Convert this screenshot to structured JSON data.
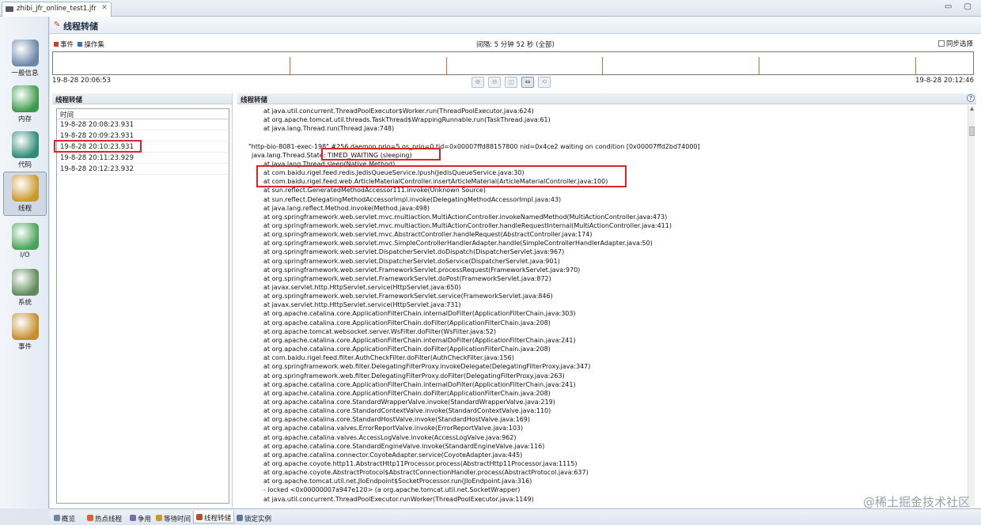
{
  "window": {
    "file_tab": "zhibi_jfr_online_test1.jfr",
    "close_glyph": "✕",
    "window_buttons": "▭ ▢"
  },
  "sidebar": {
    "items": [
      {
        "label": "一般信息",
        "icon": "chart-monitor-icon",
        "color": "#6b86a6"
      },
      {
        "label": "内存",
        "icon": "memory-chip-icon",
        "color": "#3c9a4c"
      },
      {
        "label": "代码",
        "icon": "code-java-icon",
        "color": "#2f8a76"
      },
      {
        "label": "线程",
        "icon": "thread-gears-icon",
        "color": "#c99a2e"
      },
      {
        "label": "I/O",
        "icon": "io-disk-icon",
        "color": "#4aa357"
      },
      {
        "label": "系统",
        "icon": "system-monitor-icon",
        "color": "#5f8a5a"
      },
      {
        "label": "事件",
        "icon": "event-folder-icon",
        "color": "#c68d2a"
      }
    ],
    "active_index": 3
  },
  "header": {
    "title": "线程转储",
    "icon": "thread-dump-icon"
  },
  "toolbar": {
    "legend_events": "事件",
    "legend_ops": "操作集",
    "event_color": "#d23a2a",
    "ops_color": "#3a6fb0",
    "range_label": "间隔: 5 分钟 52 秒 (全部)",
    "sync_label": "同步选择"
  },
  "timeline": {
    "start": "19-8-28 20:06:53",
    "end": "19-8-28 20:12:46",
    "marker_color": "#e36b2a",
    "markers": [
      0.257,
      0.427,
      0.597,
      0.767,
      0.937
    ]
  },
  "left_panel": {
    "title": "线程转储",
    "column_header": "时间",
    "rows": [
      "19-8-28 20:08:23.931",
      "19-8-28 20:09:23.931",
      "19-8-28 20:10:23.931",
      "19-8-28 20:11:23.929",
      "19-8-28 20:12:23.932"
    ],
    "selected_index": 2
  },
  "right_panel": {
    "title": "线程转储",
    "help_glyph": "?",
    "lines": [
      {
        "i": 2,
        "t": "at java.util.concurrent.ThreadPoolExecutor$Worker.run(ThreadPoolExecutor.java:624)"
      },
      {
        "i": 2,
        "t": "at org.apache.tomcat.util.threads.TaskThread$WrappingRunnable.run(TaskThread.java:61)"
      },
      {
        "i": 2,
        "t": "at java.lang.Thread.run(Thread.java:748)"
      },
      {
        "i": 0,
        "t": ""
      },
      {
        "i": 0,
        "t": "\"http-bio-8081-exec-198\" #256 daemon prio=5 os_prio=0 tid=0x00007ffd88157800 nid=0x4ce2 waiting on condition [0x00007ffd2bd74000]"
      },
      {
        "i": 1,
        "t": "java.lang.Thread.State: TIMED_WAITING (sleeping)"
      },
      {
        "i": 2,
        "t": "at java.lang.Thread.sleep(Native Method)"
      },
      {
        "i": 2,
        "t": "at com.baidu.rigel.feed.redis.JedisQueueService.lpush(JedisQueueService.java:30)"
      },
      {
        "i": 2,
        "t": "at com.baidu.rigel.feed.web.ArticleMaterialController.insertArticleMaterial(ArticleMaterialController.java:100)"
      },
      {
        "i": 2,
        "t": "at sun.reflect.GeneratedMethodAccessor111.invoke(Unknown Source)"
      },
      {
        "i": 2,
        "t": "at sun.reflect.DelegatingMethodAccessorImpl.invoke(DelegatingMethodAccessorImpl.java:43)"
      },
      {
        "i": 2,
        "t": "at java.lang.reflect.Method.invoke(Method.java:498)"
      },
      {
        "i": 2,
        "t": "at org.springframework.web.servlet.mvc.multiaction.MultiActionController.invokeNamedMethod(MultiActionController.java:473)"
      },
      {
        "i": 2,
        "t": "at org.springframework.web.servlet.mvc.multiaction.MultiActionController.handleRequestInternal(MultiActionController.java:411)"
      },
      {
        "i": 2,
        "t": "at org.springframework.web.servlet.mvc.AbstractController.handleRequest(AbstractController.java:174)"
      },
      {
        "i": 2,
        "t": "at org.springframework.web.servlet.mvc.SimpleControllerHandlerAdapter.handle(SimpleControllerHandlerAdapter.java:50)"
      },
      {
        "i": 2,
        "t": "at org.springframework.web.servlet.DispatcherServlet.doDispatch(DispatcherServlet.java:967)"
      },
      {
        "i": 2,
        "t": "at org.springframework.web.servlet.DispatcherServlet.doService(DispatcherServlet.java:901)"
      },
      {
        "i": 2,
        "t": "at org.springframework.web.servlet.FrameworkServlet.processRequest(FrameworkServlet.java:970)"
      },
      {
        "i": 2,
        "t": "at org.springframework.web.servlet.FrameworkServlet.doPost(FrameworkServlet.java:872)"
      },
      {
        "i": 2,
        "t": "at javax.servlet.http.HttpServlet.service(HttpServlet.java:650)"
      },
      {
        "i": 2,
        "t": "at org.springframework.web.servlet.FrameworkServlet.service(FrameworkServlet.java:846)"
      },
      {
        "i": 2,
        "t": "at javax.servlet.http.HttpServlet.service(HttpServlet.java:731)"
      },
      {
        "i": 2,
        "t": "at org.apache.catalina.core.ApplicationFilterChain.internalDoFilter(ApplicationFilterChain.java:303)"
      },
      {
        "i": 2,
        "t": "at org.apache.catalina.core.ApplicationFilterChain.doFilter(ApplicationFilterChain.java:208)"
      },
      {
        "i": 2,
        "t": "at org.apache.tomcat.websocket.server.WsFilter.doFilter(WsFilter.java:52)"
      },
      {
        "i": 2,
        "t": "at org.apache.catalina.core.ApplicationFilterChain.internalDoFilter(ApplicationFilterChain.java:241)"
      },
      {
        "i": 2,
        "t": "at org.apache.catalina.core.ApplicationFilterChain.doFilter(ApplicationFilterChain.java:208)"
      },
      {
        "i": 2,
        "t": "at com.baidu.rigel.feed.filter.AuthCheckFilter.doFilter(AuthCheckFilter.java:156)"
      },
      {
        "i": 2,
        "t": "at org.springframework.web.filter.DelegatingFilterProxy.invokeDelegate(DelegatingFilterProxy.java:347)"
      },
      {
        "i": 2,
        "t": "at org.springframework.web.filter.DelegatingFilterProxy.doFilter(DelegatingFilterProxy.java:263)"
      },
      {
        "i": 2,
        "t": "at org.apache.catalina.core.ApplicationFilterChain.internalDoFilter(ApplicationFilterChain.java:241)"
      },
      {
        "i": 2,
        "t": "at org.apache.catalina.core.ApplicationFilterChain.doFilter(ApplicationFilterChain.java:208)"
      },
      {
        "i": 2,
        "t": "at org.apache.catalina.core.StandardWrapperValve.invoke(StandardWrapperValve.java:219)"
      },
      {
        "i": 2,
        "t": "at org.apache.catalina.core.StandardContextValve.invoke(StandardContextValve.java:110)"
      },
      {
        "i": 2,
        "t": "at org.apache.catalina.core.StandardHostValve.invoke(StandardHostValve.java:169)"
      },
      {
        "i": 2,
        "t": "at org.apache.catalina.valves.ErrorReportValve.invoke(ErrorReportValve.java:103)"
      },
      {
        "i": 2,
        "t": "at org.apache.catalina.valves.AccessLogValve.invoke(AccessLogValve.java:962)"
      },
      {
        "i": 2,
        "t": "at org.apache.catalina.core.StandardEngineValve.invoke(StandardEngineValve.java:116)"
      },
      {
        "i": 2,
        "t": "at org.apache.catalina.connector.CoyoteAdapter.service(CoyoteAdapter.java:445)"
      },
      {
        "i": 2,
        "t": "at org.apache.coyote.http11.AbstractHttp11Processor.process(AbstractHttp11Processor.java:1115)"
      },
      {
        "i": 2,
        "t": "at org.apache.coyote.AbstractProtocol$AbstractConnectionHandler.process(AbstractProtocol.java:637)"
      },
      {
        "i": 2,
        "t": "at org.apache.tomcat.util.net.JIoEndpoint$SocketProcessor.run(JIoEndpoint.java:316)"
      },
      {
        "i": 2,
        "t": "- locked <0x00000007a947e120> (a org.apache.tomcat.util.net.SocketWrapper)"
      },
      {
        "i": 2,
        "t": "at java.util.concurrent.ThreadPoolExecutor.runWorker(ThreadPoolExecutor.java:1149)"
      }
    ]
  },
  "highlight_color": "#d9262a",
  "bottom_tabs": [
    {
      "label": "概览",
      "icon": "overview-icon",
      "color": "#6b86a6"
    },
    {
      "label": "热点线程",
      "icon": "hot-threads-icon",
      "color": "#d9652a"
    },
    {
      "label": "争用",
      "icon": "contention-icon",
      "color": "#7a6bb0"
    },
    {
      "label": "等待时间",
      "icon": "latency-icon",
      "color": "#c99a2e"
    },
    {
      "label": "线程转储",
      "icon": "thread-dump-icon",
      "color": "#b0502a"
    },
    {
      "label": "锁定实例",
      "icon": "lock-instances-icon",
      "color": "#5a7a9a"
    }
  ],
  "bottom_active_index": 4,
  "watermark": "@稀土掘金技术社区"
}
